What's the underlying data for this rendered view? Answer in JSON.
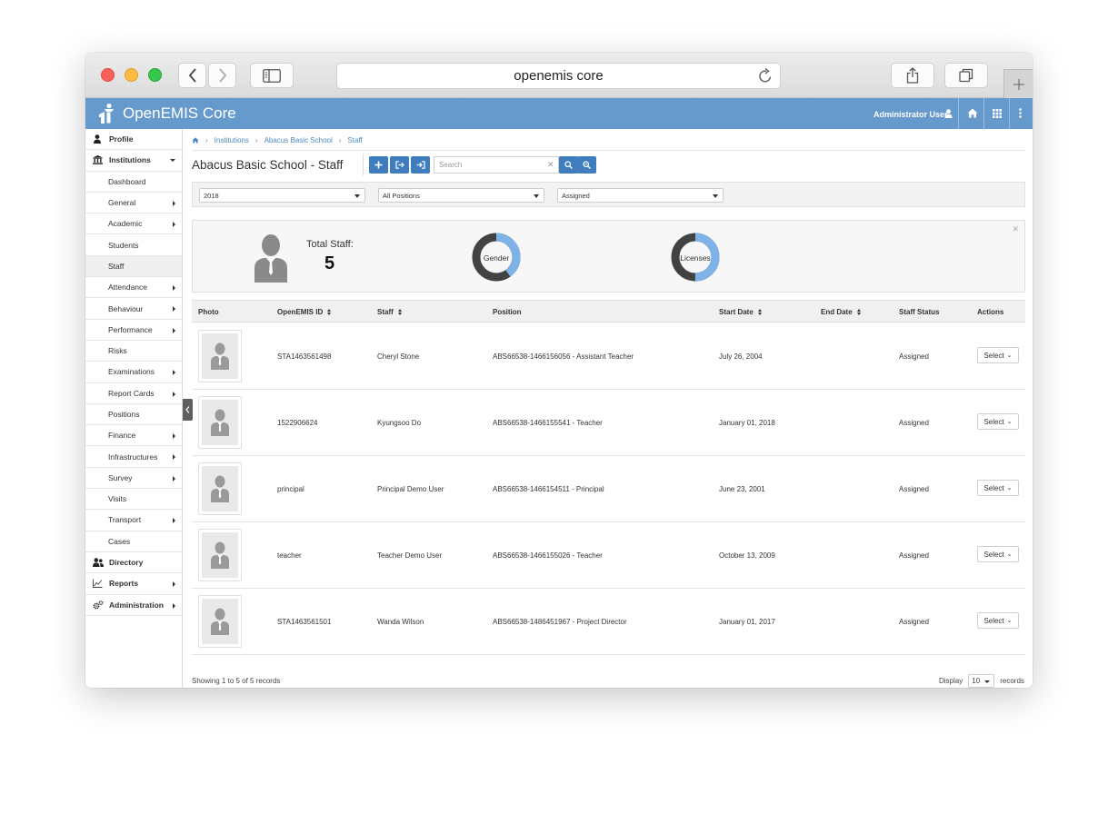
{
  "browser": {
    "url_text": "openemis core"
  },
  "app": {
    "title": "OpenEMIS Core",
    "user": "Administrator User",
    "brand_color": "#6699cc"
  },
  "sidebar": {
    "items": [
      {
        "label": "Profile",
        "level": "top",
        "icon": "user-icon",
        "arrow": "none"
      },
      {
        "label": "Institutions",
        "level": "top",
        "icon": "institution-icon",
        "arrow": "down"
      },
      {
        "label": "Dashboard",
        "level": "sub",
        "arrow": "none"
      },
      {
        "label": "General",
        "level": "sub",
        "arrow": "right"
      },
      {
        "label": "Academic",
        "level": "sub",
        "arrow": "right"
      },
      {
        "label": "Students",
        "level": "sub",
        "arrow": "none"
      },
      {
        "label": "Staff",
        "level": "sub",
        "arrow": "none",
        "active": true
      },
      {
        "label": "Attendance",
        "level": "sub",
        "arrow": "right"
      },
      {
        "label": "Behaviour",
        "level": "sub",
        "arrow": "right"
      },
      {
        "label": "Performance",
        "level": "sub",
        "arrow": "right"
      },
      {
        "label": "Risks",
        "level": "sub",
        "arrow": "none"
      },
      {
        "label": "Examinations",
        "level": "sub",
        "arrow": "right"
      },
      {
        "label": "Report Cards",
        "level": "sub",
        "arrow": "right"
      },
      {
        "label": "Positions",
        "level": "sub",
        "arrow": "none"
      },
      {
        "label": "Finance",
        "level": "sub",
        "arrow": "right"
      },
      {
        "label": "Infrastructures",
        "level": "sub",
        "arrow": "right"
      },
      {
        "label": "Survey",
        "level": "sub",
        "arrow": "right"
      },
      {
        "label": "Visits",
        "level": "sub",
        "arrow": "none"
      },
      {
        "label": "Transport",
        "level": "sub",
        "arrow": "right"
      },
      {
        "label": "Cases",
        "level": "sub",
        "arrow": "none"
      },
      {
        "label": "Directory",
        "level": "top",
        "icon": "users-icon",
        "arrow": "none"
      },
      {
        "label": "Reports",
        "level": "top",
        "icon": "chart-icon",
        "arrow": "right"
      },
      {
        "label": "Administration",
        "level": "top",
        "icon": "cogs-icon",
        "arrow": "right"
      }
    ]
  },
  "breadcrumb": {
    "items": [
      "Institutions",
      "Abacus Basic School",
      "Staff"
    ]
  },
  "page": {
    "title": "Abacus Basic School - Staff",
    "search_placeholder": "Search"
  },
  "filters": {
    "year": "2018",
    "position": "All Positions",
    "status": "Assigned"
  },
  "dashboard": {
    "total_label": "Total Staff:",
    "total_value": "5",
    "gender_label": "Gender",
    "gender_fraction": 0.4,
    "licenses_label": "Licenses",
    "licenses_fraction": 0.5,
    "dark_color": "#424242",
    "light_color": "#7db3e8"
  },
  "table": {
    "headers": {
      "photo": "Photo",
      "openemis_id": "OpenEMIS ID",
      "staff": "Staff",
      "position": "Position",
      "start_date": "Start Date",
      "end_date": "End Date",
      "staff_status": "Staff Status",
      "actions": "Actions"
    },
    "action_label": "Select",
    "rows": [
      {
        "id": "STA1463561498",
        "staff": "Cheryl Stone",
        "position": "ABS66538-1466156056 - Assistant Teacher",
        "start": "July 26, 2004",
        "end": "",
        "status": "Assigned"
      },
      {
        "id": "1522906624",
        "staff": "Kyungsoo Do",
        "position": "ABS66538-1466155541 - Teacher",
        "start": "January 01, 2018",
        "end": "",
        "status": "Assigned"
      },
      {
        "id": "principal",
        "staff": "Principal Demo User",
        "position": "ABS66538-1466154511 - Principal",
        "start": "June 23, 2001",
        "end": "",
        "status": "Assigned"
      },
      {
        "id": "teacher",
        "staff": "Teacher Demo User",
        "position": "ABS66538-1466155026 - Teacher",
        "start": "October 13, 2009",
        "end": "",
        "status": "Assigned"
      },
      {
        "id": "STA1463561501",
        "staff": "Wanda Wilson",
        "position": "ABS66538-1486451967 - Project Director",
        "start": "January 01, 2017",
        "end": "",
        "status": "Assigned"
      }
    ]
  },
  "pagination": {
    "info": "Showing 1 to 5 of 5 records",
    "display_label": "Display",
    "page_size": "10",
    "records_label": "records"
  }
}
